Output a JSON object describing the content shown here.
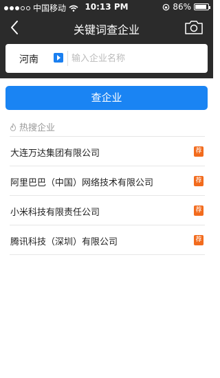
{
  "status_bar": {
    "carrier": "中国移动",
    "time": "10:13 PM",
    "battery": "86%"
  },
  "nav": {
    "title": "关键词查企业"
  },
  "search": {
    "province": "河南",
    "placeholder": "输入企业名称",
    "button_label": "查企业"
  },
  "hot": {
    "header": "热搜企业",
    "badge": "荐",
    "items": [
      {
        "label": "大连万达集团有限公司"
      },
      {
        "label": "阿里巴巴（中国）网络技术有限公司"
      },
      {
        "label": "小米科技有限责任公司"
      },
      {
        "label": "腾讯科技（深圳）有限公司"
      }
    ]
  }
}
